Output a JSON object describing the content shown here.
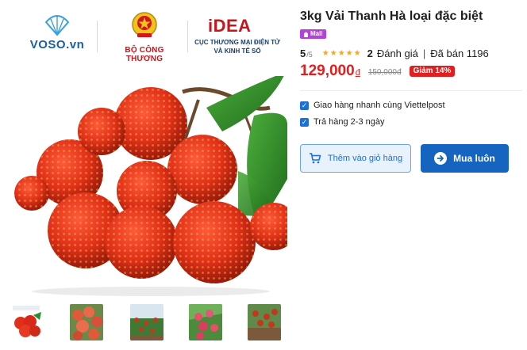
{
  "logos": {
    "voso": "VOSO.vn",
    "bct": "BỘ CÔNG THƯƠNG",
    "idea_word": "iDEA",
    "idea_sub_line1": "CỤC THƯƠNG MẠI ĐIỆN TỬ",
    "idea_sub_line2": "VÀ KINH TẾ SỐ"
  },
  "product": {
    "title": "3kg Vải Thanh Hà loại đặc biệt",
    "mall_badge": "Mall",
    "score": "5",
    "score_max": "/5",
    "review_count": "2",
    "review_label": "Đánh giá",
    "separator": "|",
    "sold_label": "Đã bán 1196",
    "price": "129,000",
    "price_unit": "đ",
    "old_price": "150,000đ",
    "discount": "Giảm 14%"
  },
  "options": [
    {
      "label": "Giao hàng nhanh cùng Viettelpost",
      "checked": true
    },
    {
      "label": "Trả hàng 2-3 ngày",
      "checked": true
    }
  ],
  "actions": {
    "add_to_cart": "Thêm vào giỏ hàng",
    "buy_now": "Mua luôn"
  },
  "colors": {
    "accent_blue": "#1565c0",
    "price_red": "#e02020",
    "mall_purple": "#b143d8",
    "star_gold": "#f5a623"
  },
  "icons": {
    "cart": "cart-icon",
    "arrow": "arrow-right-circle-icon",
    "check": "checkbox-checked-icon",
    "star": "star-icon",
    "shell": "seashell-icon",
    "emblem": "national-emblem-icon"
  }
}
